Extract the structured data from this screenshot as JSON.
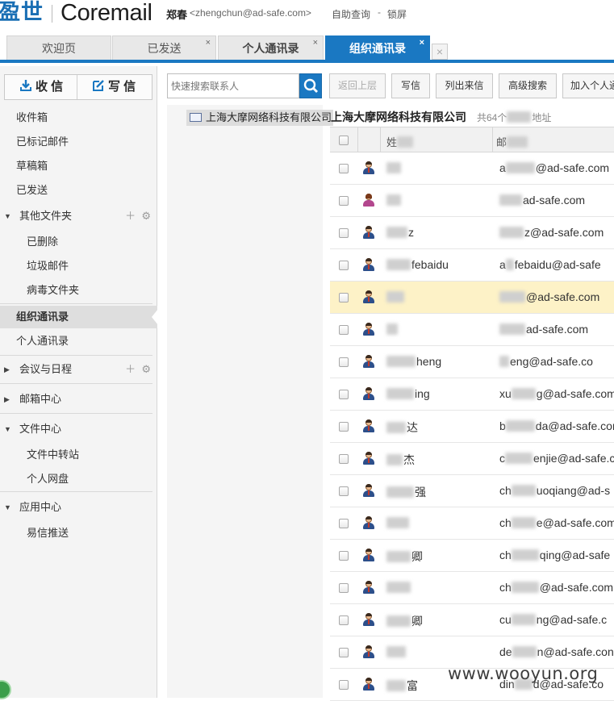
{
  "header": {
    "logo_cn": "盈世",
    "logo_en": "Coremail",
    "user_name": "郑春",
    "user_email": "<zhengchun@ad-safe.com>",
    "links": [
      "自助查询",
      "锁屏"
    ],
    "separator": "-"
  },
  "tabs": [
    {
      "label": "欢迎页",
      "closable": false,
      "active": false
    },
    {
      "label": "已发送",
      "closable": true,
      "active": false
    },
    {
      "label": "个人通讯录",
      "closable": true,
      "active": false
    },
    {
      "label": "组织通讯录",
      "closable": true,
      "active": true
    }
  ],
  "tab_close_glyph": "×",
  "sidebar": {
    "receive_label": "收 信",
    "compose_label": "写 信",
    "items": [
      {
        "label": "收件箱"
      },
      {
        "label": "已标记邮件"
      },
      {
        "label": "草稿箱"
      },
      {
        "label": "已发送"
      }
    ],
    "other_folders": {
      "label": "其他文件夹",
      "children": [
        "已删除",
        "垃圾邮件",
        "病毒文件夹"
      ]
    },
    "org_contacts": "组织通讯录",
    "personal_contacts": "个人通讯录",
    "meeting": "会议与日程",
    "mailbox_center": "邮箱中心",
    "file_center": {
      "label": "文件中心",
      "children": [
        "文件中转站",
        "个人网盘"
      ]
    },
    "app_center": {
      "label": "应用中心",
      "children": [
        "易信推送"
      ]
    }
  },
  "toolbar": {
    "search_placeholder": "快速搜索联系人",
    "buttons": [
      {
        "label": "返回上层",
        "disabled": true
      },
      {
        "label": "写信",
        "disabled": false
      },
      {
        "label": "列出来信",
        "disabled": false
      },
      {
        "label": "高级搜索",
        "disabled": false
      },
      {
        "label": "加入个人通",
        "disabled": false
      }
    ]
  },
  "tree": {
    "root": "上海大摩网络科技有限公司"
  },
  "list": {
    "title": "上海大摩网络科技有限公司",
    "count": "共64个",
    "count_suffix": "地址",
    "col_name": "姓",
    "col_mail": "邮"
  },
  "rows": [
    {
      "name": "",
      "email": "@ad-safe.com",
      "email_prefix": "a",
      "female": false,
      "hl": false
    },
    {
      "name": "",
      "email": "ad-safe.com",
      "email_prefix": "",
      "female": true,
      "hl": false
    },
    {
      "name": "z",
      "email": "z@ad-safe.com",
      "email_prefix": "",
      "female": false,
      "hl": false
    },
    {
      "name": "febaidu",
      "email": "febaidu@ad-safe",
      "email_prefix": "a",
      "female": false,
      "hl": false
    },
    {
      "name": "",
      "email": "@ad-safe.com",
      "email_prefix": "",
      "female": false,
      "hl": true
    },
    {
      "name": "",
      "email": "ad-safe.com",
      "email_prefix": "",
      "female": false,
      "hl": false
    },
    {
      "name": "heng",
      "email": "eng@ad-safe.co",
      "email_prefix": "",
      "female": false,
      "hl": false
    },
    {
      "name": "ing",
      "email": "g@ad-safe.com",
      "email_prefix": "xu",
      "female": false,
      "hl": false
    },
    {
      "name": "达",
      "email": "da@ad-safe.con",
      "email_prefix": "b",
      "female": false,
      "hl": false
    },
    {
      "name": "杰",
      "email": "enjie@ad-safe.co",
      "email_prefix": "c",
      "female": false,
      "hl": false
    },
    {
      "name": "强",
      "email": "uoqiang@ad-s",
      "email_prefix": "ch",
      "female": false,
      "hl": false
    },
    {
      "name": "",
      "email": "e@ad-safe.com",
      "email_prefix": "ch",
      "female": false,
      "hl": false
    },
    {
      "name": "卿",
      "email": "qing@ad-safe",
      "email_prefix": "ch",
      "female": false,
      "hl": false
    },
    {
      "name": "",
      "email": "@ad-safe.com",
      "email_prefix": "ch",
      "female": false,
      "hl": false
    },
    {
      "name": "卿",
      "email": "ng@ad-safe.c",
      "email_prefix": "cu",
      "female": false,
      "hl": false
    },
    {
      "name": "",
      "email": "n@ad-safe.con",
      "email_prefix": "de",
      "female": false,
      "hl": false
    },
    {
      "name": "富",
      "email": "d@ad-safe.co",
      "email_prefix": "din",
      "female": false,
      "hl": false
    }
  ],
  "watermark": "www.wooyun.org",
  "colors": {
    "accent": "#1a78c2",
    "highlight_row": "#fdf2c7"
  }
}
